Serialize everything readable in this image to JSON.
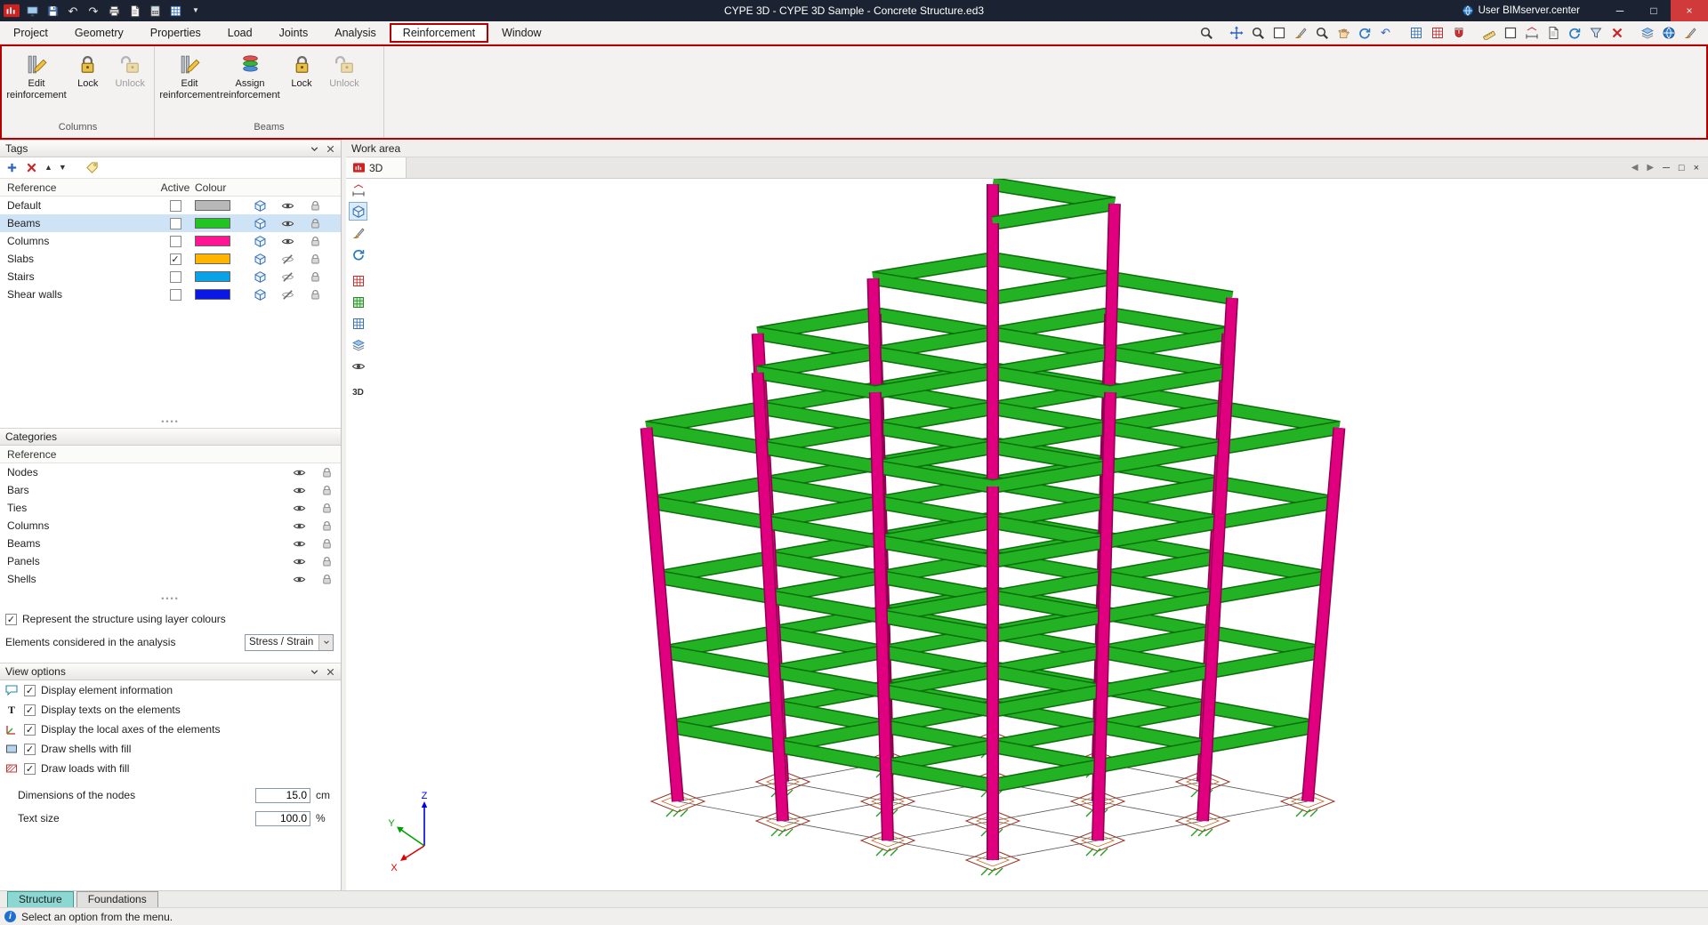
{
  "titlebar": {
    "title": "CYPE 3D - CYPE 3D Sample - Concrete Structure.ed3",
    "user": "User BIMserver.center"
  },
  "menu": {
    "items": [
      "Project",
      "Geometry",
      "Properties",
      "Load",
      "Joints",
      "Analysis",
      "Reinforcement",
      "Window"
    ],
    "active_item": "Reinforcement"
  },
  "ribbon": {
    "columns_group": {
      "label": "Columns",
      "edit": "Edit reinforcement",
      "lock": "Lock",
      "unlock": "Unlock"
    },
    "beams_group": {
      "label": "Beams",
      "edit": "Edit reinforcement",
      "assign": "Assign reinforcement",
      "lock": "Lock",
      "unlock": "Unlock"
    }
  },
  "tags": {
    "title": "Tags",
    "col_reference": "Reference",
    "col_active": "Active",
    "col_colour": "Colour",
    "rows": [
      {
        "reference": "Default",
        "active": false,
        "colour": "#b8b8b8",
        "selected": false,
        "visible": true
      },
      {
        "reference": "Beams",
        "active": false,
        "colour": "#21c421",
        "selected": true,
        "visible": true
      },
      {
        "reference": "Columns",
        "active": false,
        "colour": "#ff1493",
        "selected": false,
        "visible": true
      },
      {
        "reference": "Slabs",
        "active": true,
        "colour": "#ffb400",
        "selected": false,
        "visible": false
      },
      {
        "reference": "Stairs",
        "active": false,
        "colour": "#0aa2e6",
        "selected": false,
        "visible": false
      },
      {
        "reference": "Shear walls",
        "active": false,
        "colour": "#0a18e6",
        "selected": false,
        "visible": false
      }
    ]
  },
  "categories": {
    "title": "Categories",
    "col_reference": "Reference",
    "rows": [
      {
        "reference": "Nodes"
      },
      {
        "reference": "Bars"
      },
      {
        "reference": "Ties"
      },
      {
        "reference": "Columns"
      },
      {
        "reference": "Beams"
      },
      {
        "reference": "Panels"
      },
      {
        "reference": "Shells"
      }
    ]
  },
  "display": {
    "represent_label": "Represent the structure using layer colours",
    "represent_checked": true,
    "elements_label": "Elements considered in the analysis",
    "elements_value": "Stress / Strain"
  },
  "view_options": {
    "title": "View options",
    "options": [
      {
        "label": "Display element information",
        "checked": true
      },
      {
        "label": "Display texts on the elements",
        "checked": true
      },
      {
        "label": "Display the local axes of the elements",
        "checked": true
      },
      {
        "label": "Draw shells with fill",
        "checked": true
      },
      {
        "label": "Draw loads with fill",
        "checked": true
      }
    ],
    "nodes_label": "Dimensions of the nodes",
    "nodes_value": "15.0",
    "nodes_unit": "cm",
    "text_label": "Text size",
    "text_value": "100.0",
    "text_unit": "%"
  },
  "workarea": {
    "title": "Work area",
    "tab": "3D",
    "axes": {
      "x": "X",
      "y": "Y",
      "z": "Z"
    }
  },
  "footer": {
    "tabs": [
      "Structure",
      "Foundations"
    ],
    "active_tab": "Structure",
    "status": "Select an option from the menu."
  },
  "icons": {
    "titlebar": [
      "app-logo",
      "monitor",
      "save",
      "undo",
      "redo",
      "printer",
      "document",
      "calculator",
      "grid",
      "more"
    ],
    "menubar_right": [
      "search",
      "zoom-arrows",
      "zoom-window",
      "zoom-scale",
      "redraw-brush",
      "pan-hand",
      "orbit",
      "previous-view",
      "dxf-layers",
      "print-template",
      "snap-magnet",
      "measure-ruler",
      "frame-select",
      "dimension",
      "bar-report",
      "regenerate",
      "filter",
      "delete",
      "tile-windows",
      "bimserver-globe",
      "clean-brush"
    ],
    "viewport_strip": [
      "angle-measure",
      "view-cube",
      "paint",
      "orbit",
      "table",
      "mesh",
      "grid",
      "layers",
      "visibility-eye",
      "view-3d"
    ]
  },
  "colors": {
    "column": "#e0007f",
    "column_edge": "#8f0051",
    "beam": "#23b223",
    "beam_edge": "#0c6f0c",
    "annotation_red": "#b40000",
    "selection_blue": "#cfe3f6",
    "titlebar_bg": "#1b2332",
    "structure_tab": "#8cd7d1",
    "axis_x": "#e00000",
    "axis_y": "#00a000",
    "axis_z": "#0000e0"
  }
}
